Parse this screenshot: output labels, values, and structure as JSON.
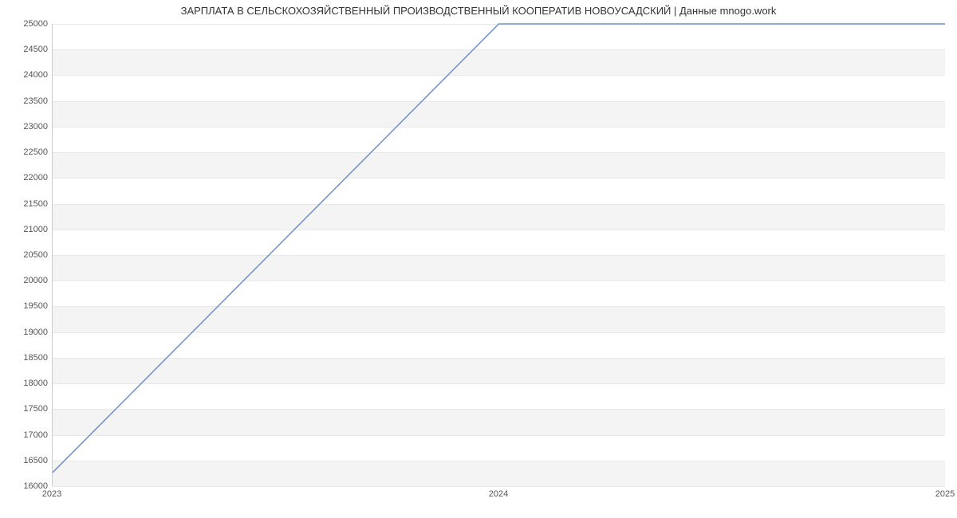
{
  "chart_data": {
    "type": "line",
    "title": "ЗАРПЛАТА В СЕЛЬСКОХОЗЯЙСТВЕННЫЙ ПРОИЗВОДСТВЕННЫЙ КООПЕРАТИВ НОВОУСАДСКИЙ | Данные mnogo.work",
    "x": [
      2023,
      2024,
      2025
    ],
    "values": [
      16250,
      25000,
      25000
    ],
    "xlabel": "",
    "ylabel": "",
    "xlim": [
      2023,
      2025
    ],
    "ylim": [
      16000,
      25000
    ],
    "x_ticks": [
      2023,
      2024,
      2025
    ],
    "y_ticks": [
      16000,
      16500,
      17000,
      17500,
      18000,
      18500,
      19000,
      19500,
      20000,
      20500,
      21000,
      21500,
      22000,
      22500,
      23000,
      23500,
      24000,
      24500,
      25000
    ],
    "line_color": "#6f90c8",
    "band_color": "#f4f4f4"
  }
}
